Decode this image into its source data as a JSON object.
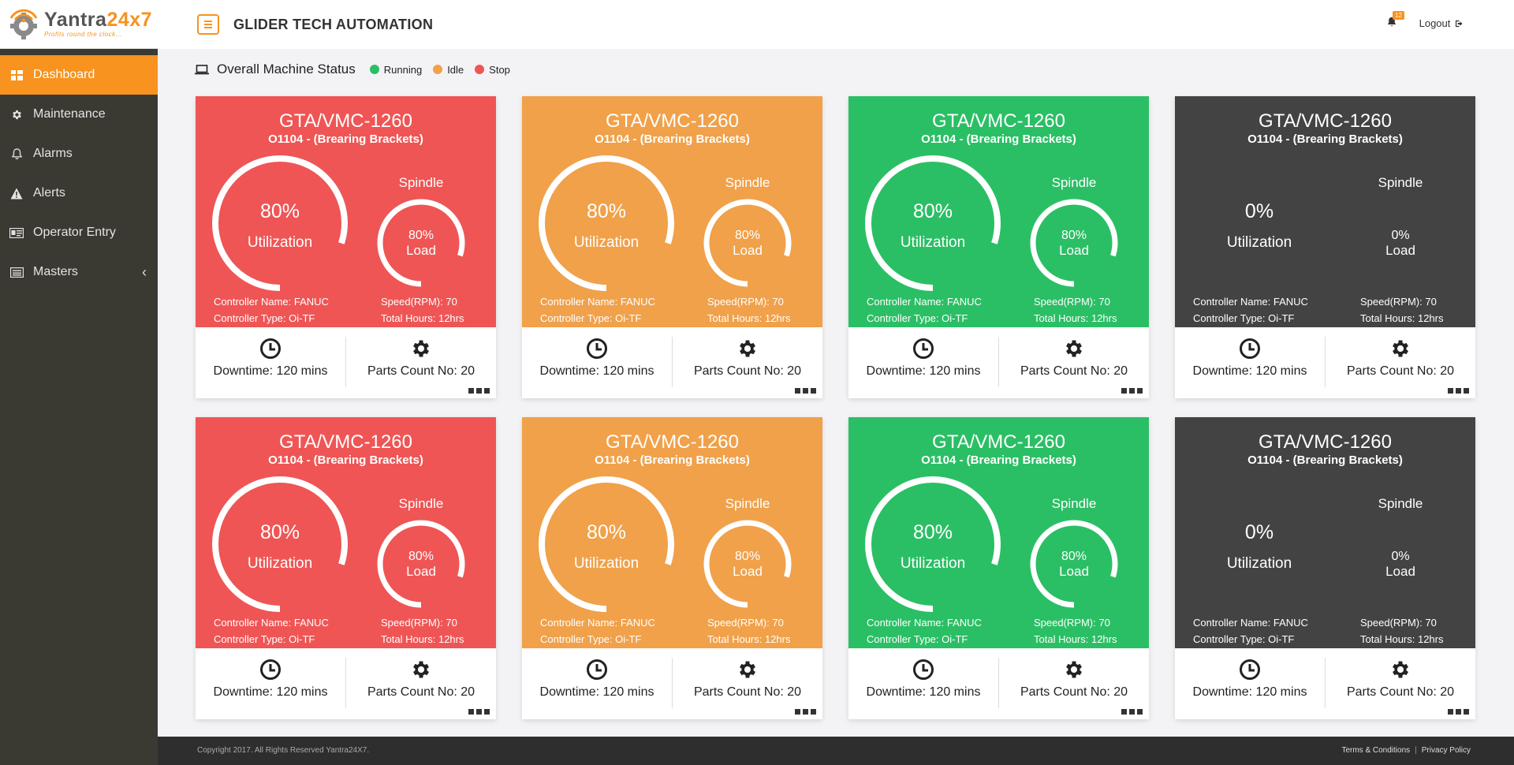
{
  "brand": {
    "name_prefix": "Yantra",
    "name_accent": "24x7",
    "tagline": "Profits round the clock...",
    "accent_color": "#f7931e"
  },
  "header": {
    "title": "GLIDER TECH AUTOMATION",
    "notification_count": "12",
    "logout_label": "Logout"
  },
  "sidebar": {
    "items": [
      {
        "label": "Dashboard",
        "icon": "dashboard-icon",
        "active": true
      },
      {
        "label": "Maintenance",
        "icon": "gear-icon",
        "active": false
      },
      {
        "label": "Alarms",
        "icon": "bell-icon",
        "active": false
      },
      {
        "label": "Alerts",
        "icon": "warning-icon",
        "active": false
      },
      {
        "label": "Operator Entry",
        "icon": "id-card-icon",
        "active": false
      },
      {
        "label": "Masters",
        "icon": "list-icon",
        "active": false
      }
    ]
  },
  "status": {
    "title": "Overall Machine Status",
    "legend": [
      {
        "label": "Running",
        "color": "#2bbf65"
      },
      {
        "label": "Idle",
        "color": "#f0a14a"
      },
      {
        "label": "Stop",
        "color": "#ef5555"
      }
    ]
  },
  "cards": [
    {
      "status": "stop",
      "title": "GTA/VMC-1260",
      "subtitle": "O1104 - (Brearing Brackets)",
      "utilization_value": "80%",
      "utilization_label": "Utilization",
      "utilization": 0.8,
      "spindle_label": "Spindle",
      "load_value": "80%",
      "load_label": "Load",
      "load": 0.8,
      "controller_name": "Controller Name: FANUC",
      "controller_type": "Controller Type: Oi-TF",
      "speed": "Speed(RPM): 70",
      "total_hours": "Total Hours: 12hrs",
      "downtime": "Downtime: 120 mins",
      "parts_count": "Parts Count No: 20"
    },
    {
      "status": "idle",
      "title": "GTA/VMC-1260",
      "subtitle": "O1104 - (Brearing Brackets)",
      "utilization_value": "80%",
      "utilization_label": "Utilization",
      "utilization": 0.8,
      "spindle_label": "Spindle",
      "load_value": "80%",
      "load_label": "Load",
      "load": 0.8,
      "controller_name": "Controller Name: FANUC",
      "controller_type": "Controller Type: Oi-TF",
      "speed": "Speed(RPM): 70",
      "total_hours": "Total Hours: 12hrs",
      "downtime": "Downtime: 120 mins",
      "parts_count": "Parts Count No: 20"
    },
    {
      "status": "running",
      "title": "GTA/VMC-1260",
      "subtitle": "O1104 - (Brearing Brackets)",
      "utilization_value": "80%",
      "utilization_label": "Utilization",
      "utilization": 0.8,
      "spindle_label": "Spindle",
      "load_value": "80%",
      "load_label": "Load",
      "load": 0.8,
      "controller_name": "Controller Name: FANUC",
      "controller_type": "Controller Type: Oi-TF",
      "speed": "Speed(RPM): 70",
      "total_hours": "Total Hours: 12hrs",
      "downtime": "Downtime: 120 mins",
      "parts_count": "Parts Count No: 20"
    },
    {
      "status": "offline",
      "title": "GTA/VMC-1260",
      "subtitle": "O1104 - (Brearing Brackets)",
      "utilization_value": "0%",
      "utilization_label": "Utilization",
      "utilization": 0,
      "spindle_label": "Spindle",
      "load_value": "0%",
      "load_label": "Load",
      "load": 0,
      "controller_name": "Controller Name: FANUC",
      "controller_type": "Controller Type: Oi-TF",
      "speed": "Speed(RPM): 70",
      "total_hours": "Total Hours: 12hrs",
      "downtime": "Downtime: 120 mins",
      "parts_count": "Parts Count No: 20"
    },
    {
      "status": "stop",
      "title": "GTA/VMC-1260",
      "subtitle": "O1104 - (Brearing Brackets)",
      "utilization_value": "80%",
      "utilization_label": "Utilization",
      "utilization": 0.8,
      "spindle_label": "Spindle",
      "load_value": "80%",
      "load_label": "Load",
      "load": 0.8,
      "controller_name": "Controller Name: FANUC",
      "controller_type": "Controller Type: Oi-TF",
      "speed": "Speed(RPM): 70",
      "total_hours": "Total Hours: 12hrs",
      "downtime": "Downtime: 120 mins",
      "parts_count": "Parts Count No: 20"
    },
    {
      "status": "idle",
      "title": "GTA/VMC-1260",
      "subtitle": "O1104 - (Brearing Brackets)",
      "utilization_value": "80%",
      "utilization_label": "Utilization",
      "utilization": 0.8,
      "spindle_label": "Spindle",
      "load_value": "80%",
      "load_label": "Load",
      "load": 0.8,
      "controller_name": "Controller Name: FANUC",
      "controller_type": "Controller Type: Oi-TF",
      "speed": "Speed(RPM): 70",
      "total_hours": "Total Hours: 12hrs",
      "downtime": "Downtime: 120 mins",
      "parts_count": "Parts Count No: 20"
    },
    {
      "status": "running",
      "title": "GTA/VMC-1260",
      "subtitle": "O1104 - (Brearing Brackets)",
      "utilization_value": "80%",
      "utilization_label": "Utilization",
      "utilization": 0.8,
      "spindle_label": "Spindle",
      "load_value": "80%",
      "load_label": "Load",
      "load": 0.8,
      "controller_name": "Controller Name: FANUC",
      "controller_type": "Controller Type: Oi-TF",
      "speed": "Speed(RPM): 70",
      "total_hours": "Total Hours: 12hrs",
      "downtime": "Downtime: 120 mins",
      "parts_count": "Parts Count No: 20"
    },
    {
      "status": "offline",
      "title": "GTA/VMC-1260",
      "subtitle": "O1104 - (Brearing Brackets)",
      "utilization_value": "0%",
      "utilization_label": "Utilization",
      "utilization": 0,
      "spindle_label": "Spindle",
      "load_value": "0%",
      "load_label": "Load",
      "load": 0,
      "controller_name": "Controller Name: FANUC",
      "controller_type": "Controller Type: Oi-TF",
      "speed": "Speed(RPM): 70",
      "total_hours": "Total Hours: 12hrs",
      "downtime": "Downtime: 120 mins",
      "parts_count": "Parts Count No: 20"
    }
  ],
  "status_colors": {
    "stop": "#ef5555",
    "idle": "#f0a14a",
    "running": "#2bbf65",
    "offline": "#434343"
  },
  "footer": {
    "copyright": "Copyright 2017. All Rights Reserved Yantra24X7.",
    "terms": "Terms & Conditions",
    "separator": "|",
    "privacy": "Privacy Policy"
  }
}
